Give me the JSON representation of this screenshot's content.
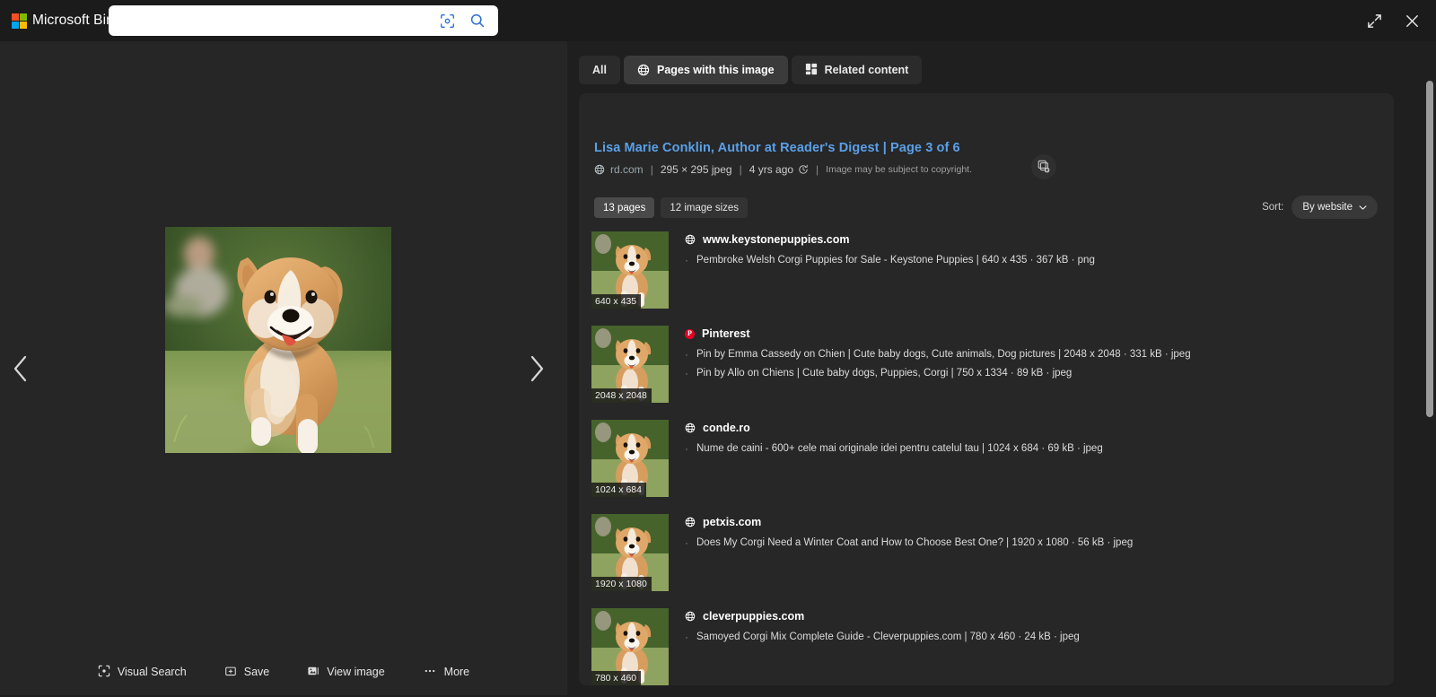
{
  "header": {
    "brand": "Microsoft Bing",
    "search_value": "",
    "search_placeholder": "",
    "visual_search_icon": "camera-lens-icon",
    "search_icon": "magnifier-icon",
    "expand_icon": "expand-diagonal-icon",
    "close_icon": "close-x-icon",
    "accent_blue": "#2b6fd4"
  },
  "image_pane": {
    "prev_label": "‹",
    "next_label": "›",
    "actions": [
      {
        "label": "Visual Search",
        "icon": "visual-search-icon"
      },
      {
        "label": "Save",
        "icon": "save-icon"
      },
      {
        "label": "View image",
        "icon": "view-image-icon"
      },
      {
        "label": "More",
        "icon": "more-dots-icon"
      }
    ]
  },
  "tabs": [
    {
      "label": "All",
      "icon": "",
      "active": false
    },
    {
      "label": "Pages with this image",
      "icon": "globe-icon",
      "active": true
    },
    {
      "label": "Related content",
      "icon": "grid-icon",
      "active": false
    }
  ],
  "result": {
    "title": "Lisa Marie Conklin, Author at Reader's Digest | Page 3 of 6",
    "title_color": "#5aa0e8",
    "domain": "rd.com",
    "dimensions": "295 × 295 jpeg",
    "age": "4 yrs ago",
    "copyright": "Image may be subject to copyright.",
    "stack_icon": "image-stack-icon",
    "clock_icon": "clock-icon"
  },
  "filters": {
    "chips": [
      {
        "label": "13 pages",
        "active": true
      },
      {
        "label": "12 image sizes",
        "active": false
      }
    ],
    "sort_label": "Sort:",
    "sort_value": "By website",
    "sort_caret": "chevron-down-icon"
  },
  "rows": [
    {
      "site": "www.keystonepuppies.com",
      "favicon": "globe-icon",
      "thumb_badge": "640 x 435",
      "entries": [
        "Pembroke Welsh Corgi Puppies for Sale - Keystone Puppies | 640 x 435 · 367 kB · png"
      ]
    },
    {
      "site": "Pinterest",
      "favicon": "pinterest-icon",
      "thumb_badge": "2048 x 2048",
      "entries": [
        "Pin by Emma Cassedy on Chien | Cute baby dogs, Cute animals, Dog pictures | 2048 x 2048 · 331 kB · jpeg",
        "Pin by Allo on Chiens | Cute baby dogs, Puppies, Corgi | 750 x 1334 · 89 kB · jpeg"
      ]
    },
    {
      "site": "conde.ro",
      "favicon": "globe-icon",
      "thumb_badge": "1024 x 684",
      "entries": [
        "Nume de caini - 600+ cele mai originale idei pentru catelul tau | 1024 x 684 · 69 kB · jpeg"
      ]
    },
    {
      "site": "petxis.com",
      "favicon": "globe-icon",
      "thumb_badge": "1920 x 1080",
      "entries": [
        "Does My Corgi Need a Winter Coat and How to Choose Best One? | 1920 x 1080 · 56 kB · jpeg"
      ]
    },
    {
      "site": "cleverpuppies.com",
      "favicon": "globe-icon",
      "thumb_badge": "780 x 460",
      "entries": [
        "Samoyed Corgi Mix Complete Guide - Cleverpuppies.com | 780 x 460 · 24 kB · jpeg"
      ]
    }
  ]
}
